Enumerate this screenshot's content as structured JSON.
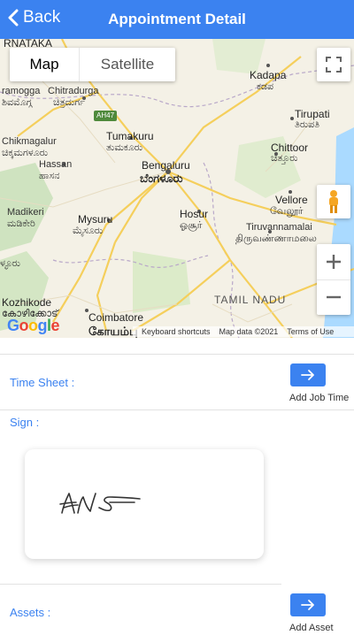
{
  "header": {
    "back_label": "Back",
    "title": "Appointment Detail"
  },
  "map": {
    "type_map": "Map",
    "type_satellite": "Satellite",
    "places": [
      {
        "text": "RNATAKA",
        "cls": "big"
      },
      {
        "text": "Kadapa",
        "cls": "big"
      },
      {
        "text": "ಕಡಪ",
        "cls": ""
      },
      {
        "text": "ramogga",
        "cls": ""
      },
      {
        "text": "Chitradurga",
        "cls": ""
      },
      {
        "text": "ಶಿವಮೊಗ್ಗ",
        "cls": ""
      },
      {
        "text": "ಚಿತ್ರದುರ್ಗ",
        "cls": ""
      },
      {
        "text": "Tirupati",
        "cls": "big"
      },
      {
        "text": "ತಿರುಪತಿ",
        "cls": ""
      },
      {
        "text": "AH47",
        "cls": ""
      },
      {
        "text": "Tumakuru",
        "cls": "big"
      },
      {
        "text": "ತುಮಕೂರು",
        "cls": ""
      },
      {
        "text": "Chikmagalur",
        "cls": ""
      },
      {
        "text": "ಚಿಕ್ಕಮಗಳೂರು",
        "cls": ""
      },
      {
        "text": "Chittoor",
        "cls": "big"
      },
      {
        "text": "ಚಿತ್ತೂರು",
        "cls": ""
      },
      {
        "text": "Bengaluru",
        "cls": "big"
      },
      {
        "text": "ಬೆಂಗಳೂರು",
        "cls": "bold"
      },
      {
        "text": "Hassan",
        "cls": ""
      },
      {
        "text": "ಹಾಸನ",
        "cls": ""
      },
      {
        "text": "Vellore",
        "cls": "big"
      },
      {
        "text": "வேலூர்",
        "cls": ""
      },
      {
        "text": "Hosur",
        "cls": "big"
      },
      {
        "text": "ஓசூர்",
        "cls": ""
      },
      {
        "text": "Tiruvannamalai",
        "cls": ""
      },
      {
        "text": "திருவண்ணாமலை",
        "cls": ""
      },
      {
        "text": "Madikeri",
        "cls": ""
      },
      {
        "text": "ಮಡಿಕೇರಿ",
        "cls": ""
      },
      {
        "text": "Mysuru",
        "cls": "big"
      },
      {
        "text": "ಮೈಸೂರು",
        "cls": ""
      },
      {
        "text": "ಳ್ಳೂರು",
        "cls": ""
      },
      {
        "text": "TAMIL NADU",
        "cls": "big"
      },
      {
        "text": "Kozhikode",
        "cls": "big"
      },
      {
        "text": "കോഴിക്കോട്",
        "cls": ""
      },
      {
        "text": "Coimbatore",
        "cls": "big"
      },
      {
        "text": "கோயம்பு",
        "cls": "bold"
      }
    ],
    "google_logo": "Google",
    "keyboard_shortcuts": "Keyboard shortcuts",
    "map_data": "Map data ©2021",
    "terms": "Terms of Use"
  },
  "timesheet": {
    "label": "Time Sheet :",
    "button_caption": "Add Job Time"
  },
  "sign": {
    "label": "Sign :"
  },
  "assets": {
    "label": "Assets :",
    "button_caption": "Add Asset"
  },
  "colors": {
    "accent": "#3b82f0"
  }
}
